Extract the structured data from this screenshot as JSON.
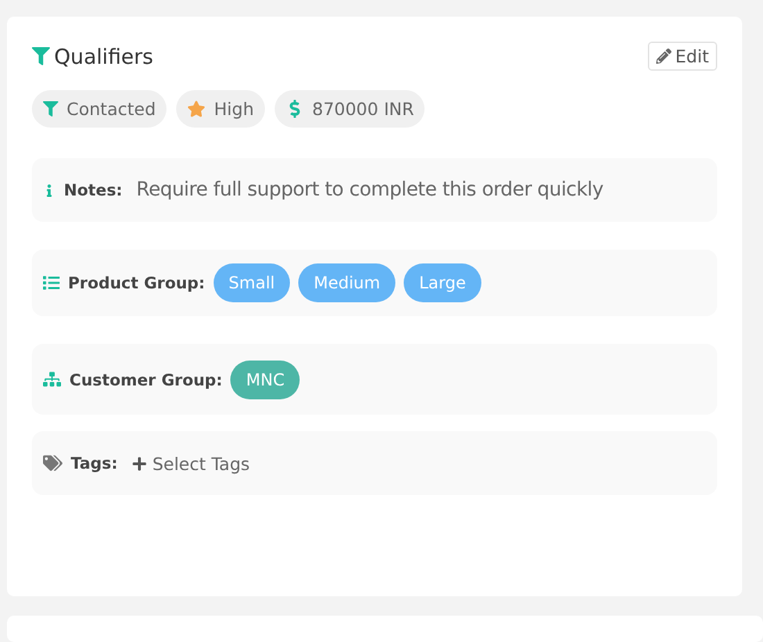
{
  "panel": {
    "title": "Qualifiers",
    "edit_button": "Edit"
  },
  "badges": [
    {
      "kind": "stage",
      "label": "Contacted"
    },
    {
      "kind": "priority",
      "label": "High"
    },
    {
      "kind": "value",
      "label": "870000 INR"
    }
  ],
  "sections": [
    {
      "kind": "notes",
      "label": "Notes:",
      "text": "Require full support to complete this order quickly"
    },
    {
      "kind": "products",
      "label": "Product Group:",
      "chips": [
        {
          "label": "Small",
          "color": "#64b5f6"
        },
        {
          "label": "Medium",
          "color": "#64b5f6"
        },
        {
          "label": "Large",
          "color": "#64b5f6"
        }
      ]
    },
    {
      "kind": "customers",
      "label": "Customer Group:",
      "chips": [
        {
          "label": "MNC",
          "color": "#4db6a6"
        }
      ]
    },
    {
      "kind": "tags",
      "label": "Tags:",
      "action": "Select Tags"
    }
  ]
}
